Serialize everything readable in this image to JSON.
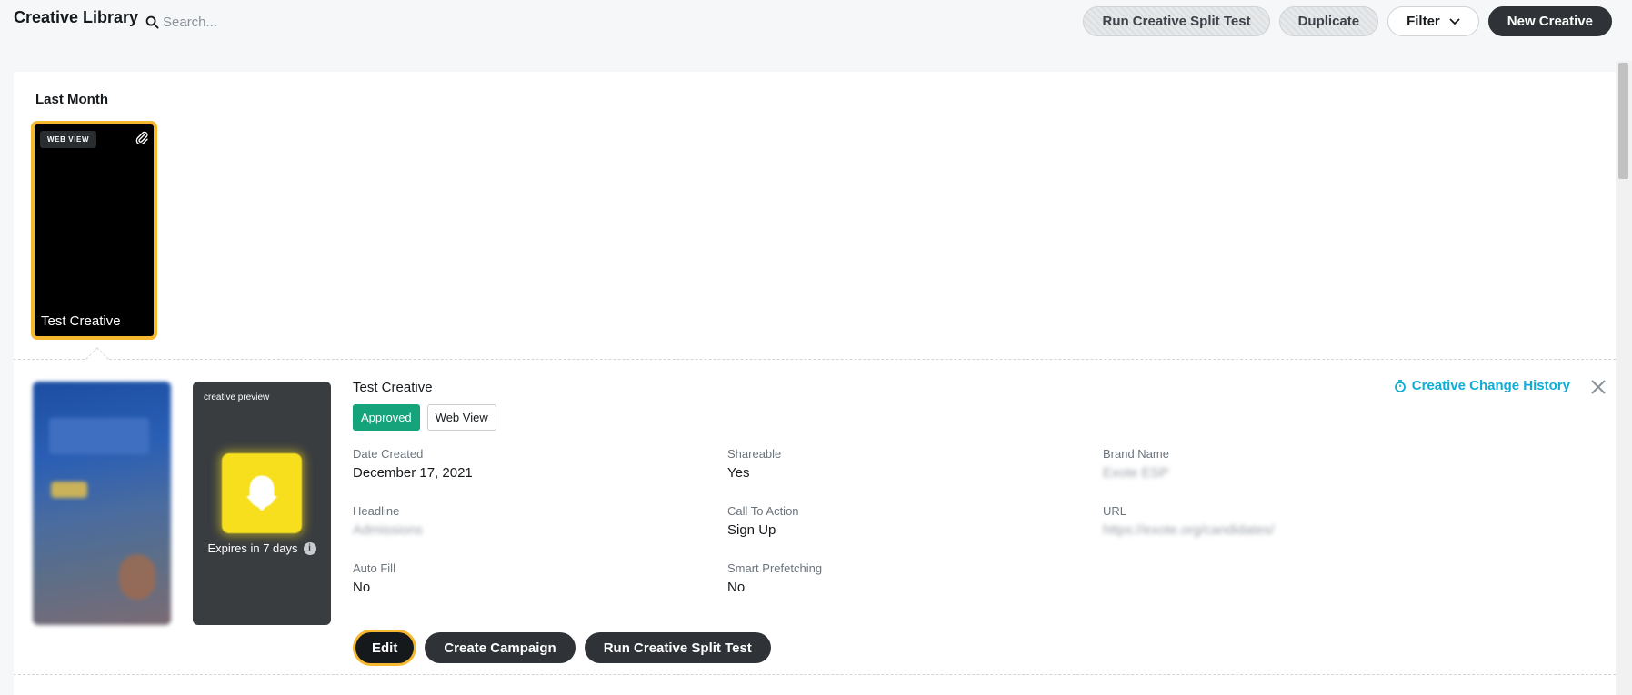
{
  "header": {
    "title": "Creative Library",
    "search_placeholder": "Search...",
    "run_split_test_label": "Run Creative Split Test",
    "duplicate_label": "Duplicate",
    "filter_label": "Filter",
    "new_creative_label": "New Creative"
  },
  "library": {
    "section_title": "Last Month",
    "tile": {
      "badge": "WEB VIEW",
      "name": "Test Creative"
    }
  },
  "detail": {
    "preview_label": "creative preview",
    "expires_text": "Expires in 7 days",
    "info_glyph": "i",
    "title": "Test Creative",
    "status_badge": "Approved",
    "type_badge": "Web View",
    "change_history_label": "Creative Change History",
    "fields": {
      "date_created": {
        "label": "Date Created",
        "value": "December 17, 2021"
      },
      "shareable": {
        "label": "Shareable",
        "value": "Yes"
      },
      "brand_name": {
        "label": "Brand Name",
        "value": "Exote ESP"
      },
      "headline": {
        "label": "Headline",
        "value": "Admissions"
      },
      "call_to_action": {
        "label": "Call To Action",
        "value": "Sign Up"
      },
      "url": {
        "label": "URL",
        "value": "https://exote.org/candidates/"
      },
      "auto_fill": {
        "label": "Auto Fill",
        "value": "No"
      },
      "smart_prefetching": {
        "label": "Smart Prefetching",
        "value": "No"
      }
    },
    "actions": {
      "edit_label": "Edit",
      "create_campaign_label": "Create Campaign",
      "run_split_test_label": "Run Creative Split Test"
    }
  },
  "colors": {
    "accent_yellow": "#f5b82e",
    "approved_green": "#14a37a",
    "link_blue": "#0fadd6",
    "dark_button": "#2f3337"
  },
  "icons": {
    "search": "search-icon",
    "chevron": "chevron-down-icon",
    "attachment": "paperclip-icon",
    "ghost": "ghost-icon",
    "history": "stopwatch-icon",
    "close": "close-icon",
    "info": "info-icon"
  }
}
